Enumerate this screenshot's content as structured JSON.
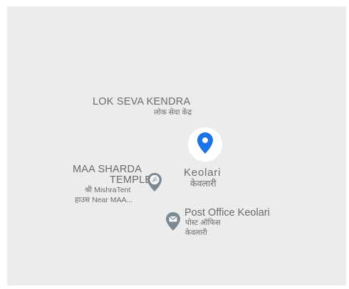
{
  "map": {
    "background_color": "#ececec",
    "places": {
      "lok_seva_kendra": {
        "name_en": "LOK SEVA KENDRA",
        "name_hi": "लोक सेवा केंद्र"
      },
      "maa_sharda_temple": {
        "line1": "MAA SHARDA",
        "line2": "TEMPLE",
        "line3": "श्री MishraTent",
        "line4": "हाउस Near MAA...",
        "icon": "om-icon"
      },
      "keolari": {
        "name_en": "Keolari",
        "name_hi": "केवलारी",
        "icon": "location-pin-icon",
        "pin_color": "#1a73e8"
      },
      "post_office": {
        "name_en": "Post Office Keolari",
        "name_hi_1": "पोस्ट ऑफिस",
        "name_hi_2": "केवलारी",
        "icon": "mail-icon"
      }
    },
    "poi_marker_color": "#7b8a92"
  }
}
